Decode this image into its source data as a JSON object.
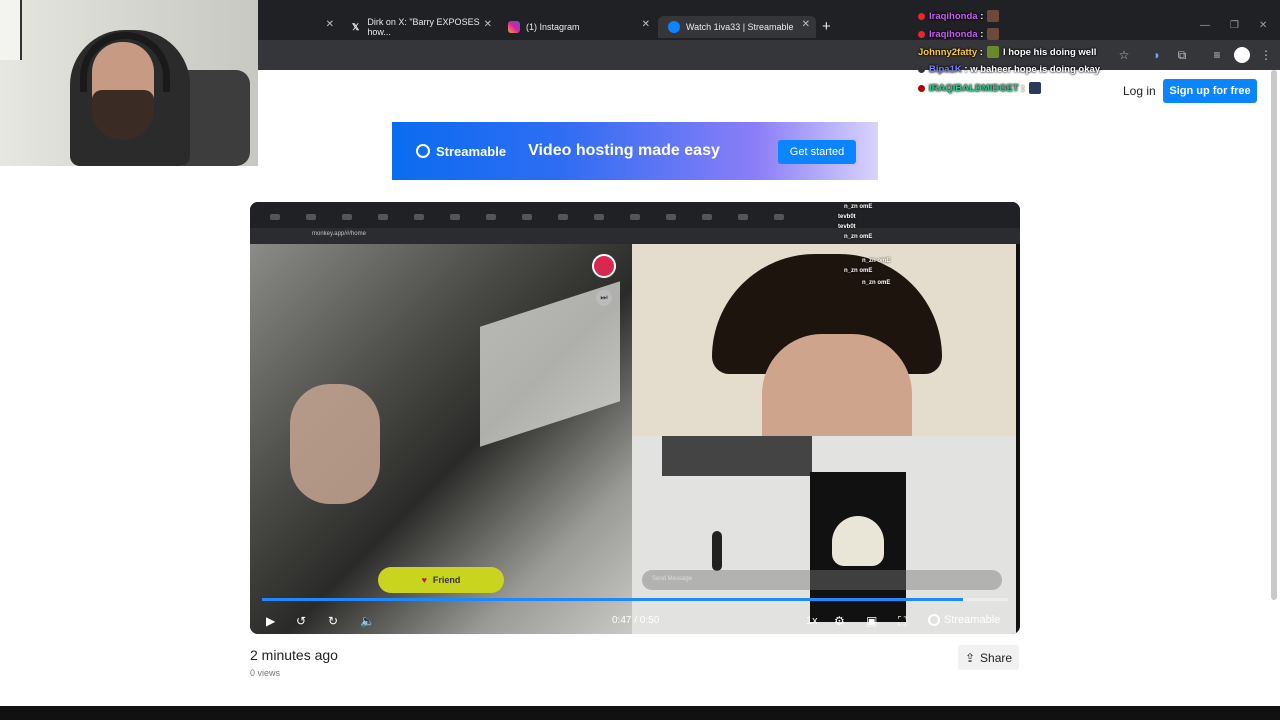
{
  "browser": {
    "tabs": [
      {
        "title": "",
        "favicon": ""
      },
      {
        "title": "Dirk on X: \"Barry EXPOSES how...",
        "favicon": "X"
      },
      {
        "title": "(1) Instagram",
        "favicon": "instagram-icon"
      },
      {
        "title": "Watch 1iva33 | Streamable",
        "favicon": "streamable-icon"
      }
    ],
    "new_tab_label": "+"
  },
  "chat": [
    {
      "user": "Iraqihonda",
      "message": "",
      "color": "#c65cf0"
    },
    {
      "user": "Iraqihonda",
      "message": "",
      "color": "#c65cf0"
    },
    {
      "user": "Johnny2fatty",
      "message": "I hope his doing well",
      "color": "#ffcc33"
    },
    {
      "user": "Bipa1K",
      "message": "w baheer hope is doing okay",
      "color": "#7b7bff"
    },
    {
      "user": "IRAQIBALDMIDGET",
      "message": "",
      "color": "#33c28a"
    }
  ],
  "header": {
    "login_label": "Log in",
    "signup_label": "Sign up for free"
  },
  "banner": {
    "brand": "Streamable",
    "tagline": "Video hosting made easy",
    "cta": "Get started"
  },
  "video": {
    "inner_url": "monkey.app/#/home",
    "friend_label": "Friend",
    "message_placeholder": "Send Message",
    "inner_chat": [
      "n_zn omE",
      "tevb0t",
      "tevb0t",
      "n_zn omE",
      "n_zn omE",
      "n_zn omE",
      "n_zn omE"
    ],
    "current_time": "0:47",
    "duration": "0:50",
    "time_display": "0:47 / 0:50",
    "progress": 0.94,
    "speed": "1x",
    "brand": "Streamable"
  },
  "meta": {
    "posted": "2 minutes ago",
    "views": "0 views",
    "share_label": "Share"
  }
}
